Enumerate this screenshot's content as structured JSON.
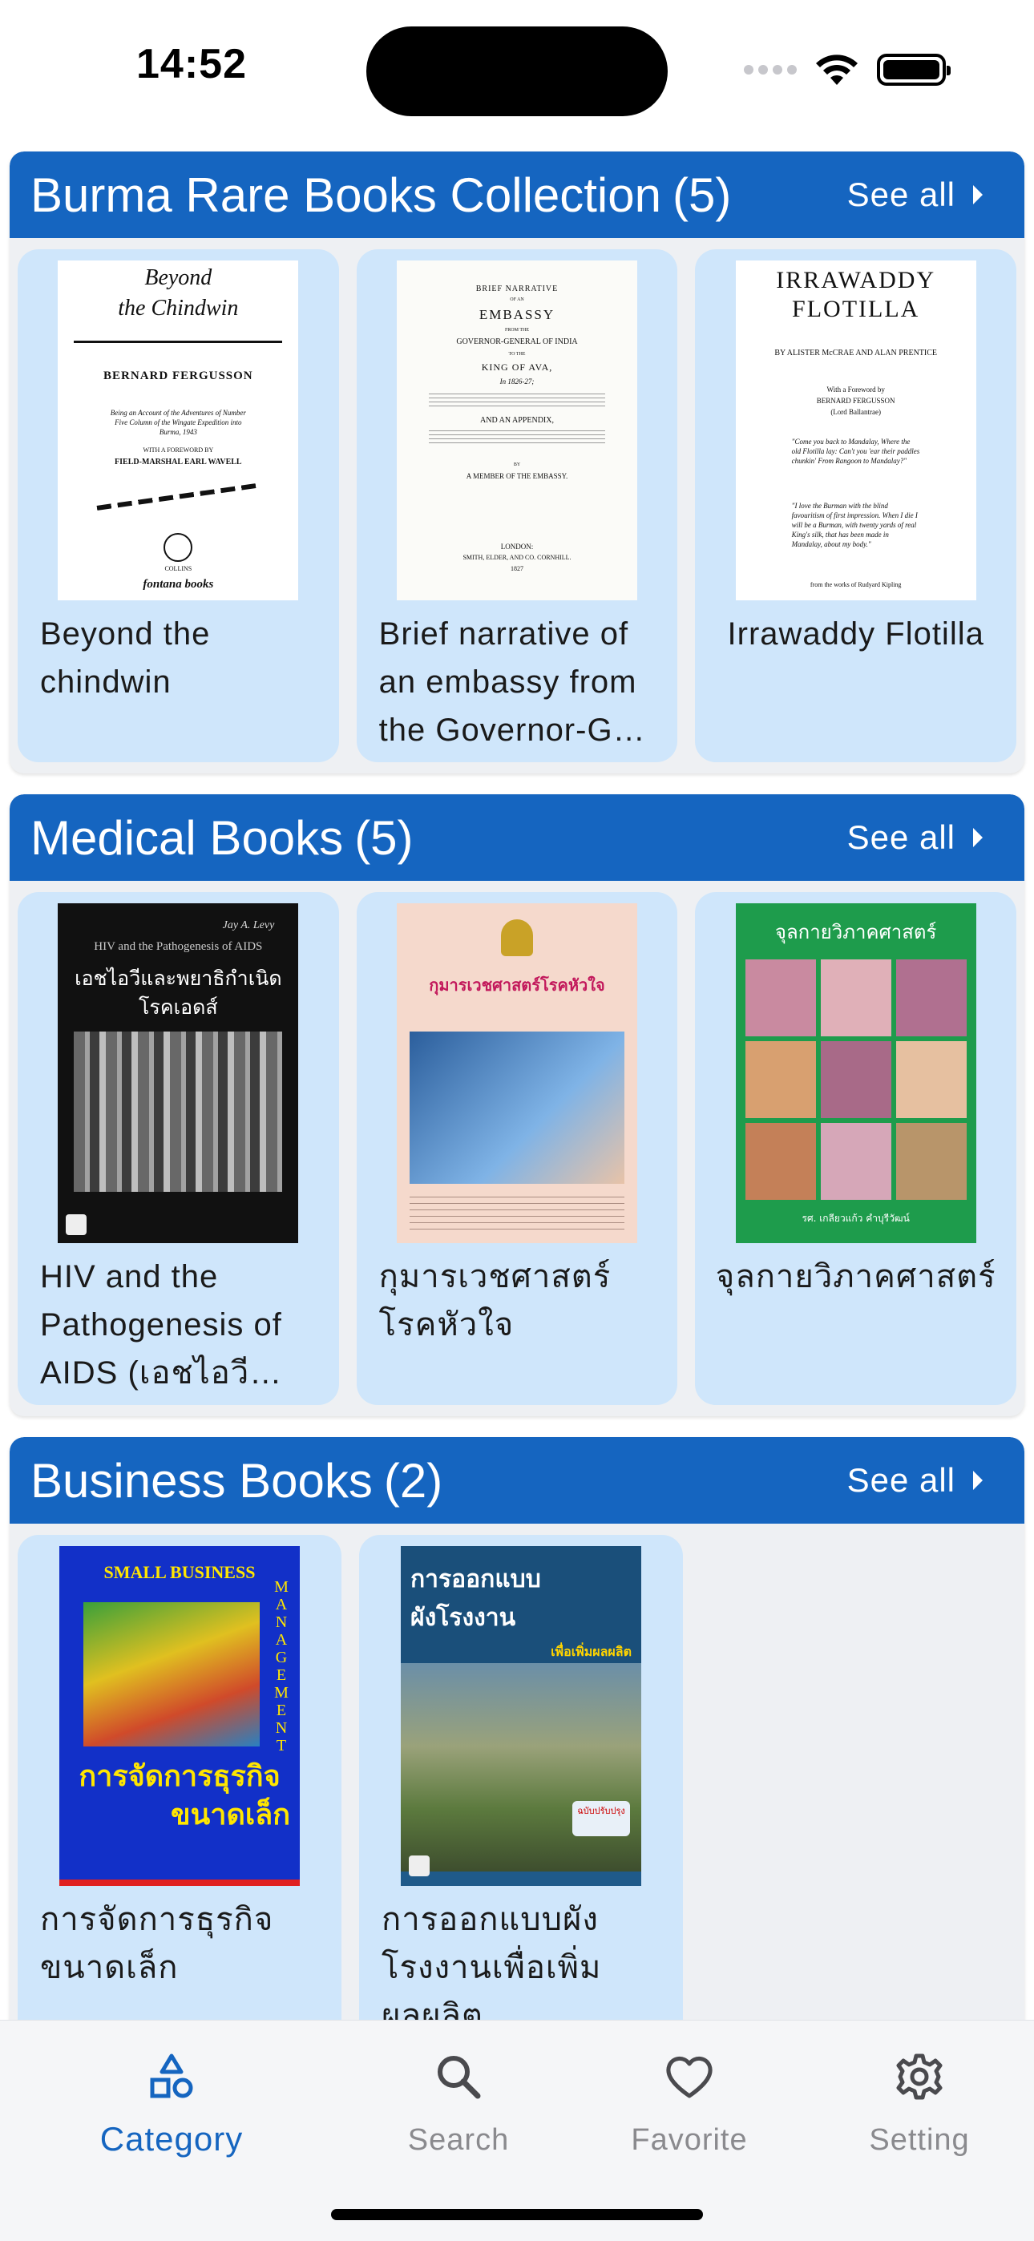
{
  "status_bar": {
    "time": "14:52"
  },
  "sections": [
    {
      "title": "Burma Rare Books Collection",
      "count": "(5)",
      "see_all": "See all",
      "books": [
        {
          "title": "Beyond the chindwin",
          "cover": {
            "line1": "Beyond",
            "line2": "the Chindwin",
            "author": "BERNARD FERGUSSON",
            "note": "Being an Account of the Adventures of Number Five Column of the Wingate Expedition into Burma, 1943",
            "foreword": "WITH A FOREWORD BY",
            "foreword_by": "FIELD-MARSHAL EARL WAVELL",
            "publisher1": "COLLINS",
            "publisher2": "fontana books"
          }
        },
        {
          "title": "Brief narrative of an embassy from the Governor-G…",
          "cover": {
            "l1": "BRIEF NARRATIVE",
            "l2": "OF AN",
            "l3": "EMBASSY",
            "l4": "FROM THE",
            "l5": "GOVERNOR-GENERAL OF INDIA",
            "l6": "TO THE",
            "l7": "KING OF AVA,",
            "l8": "In 1826-27;",
            "l9": "AND AN APPENDIX,",
            "l10": "BY",
            "l11": "A MEMBER OF THE EMBASSY.",
            "l12": "LONDON:",
            "l13": "SMITH, ELDER, AND CO. CORNHILL.",
            "l14": "1827"
          }
        },
        {
          "title": "Irrawaddy Flotilla",
          "cover": {
            "l1": "IRRAWADDY",
            "l2": "FLOTILLA",
            "l3": "BY ALISTER McCRAE AND ALAN PRENTICE",
            "l4": "With a Foreword by",
            "l5": "BERNARD FERGUSSON",
            "l6": "(Lord Ballantrae)",
            "q1": "\"Come you back to Mandalay, Where the old Flotilla lay: Can't you 'ear their paddles chunkin' From Rangoon to Mandalay?\"",
            "q2": "\"I love the Burman with the blind favouritism of first impression. When I die I will be a Burman, with twenty yards of real King's silk, that has been made in Mandalay, about my body.\"",
            "q3": "from the works of Rudyard Kipling"
          }
        }
      ]
    },
    {
      "title": "Medical Books",
      "count": "(5)",
      "see_all": "See all",
      "books": [
        {
          "title": "HIV and the Pathogenesis of AIDS (เอชไอวีแล…",
          "cover": {
            "author": "Jay A. Levy",
            "en": "HIV and the Pathogenesis of AIDS",
            "th": "เอชไอวีและพยาธิกำเนิดโรคเอดส์"
          }
        },
        {
          "title": "กุมารเวชศาสตร์โรคหัวใจ",
          "cover": {
            "th": "กุมารเวชศาสตร์โรคหัวใจ"
          }
        },
        {
          "title": "จุลกายวิภาคศาสตร์",
          "cover": {
            "th": "จุลกายวิภาคศาสตร์",
            "author": "รศ. เกลียวแก้ว คำบุรีวัฒน์"
          }
        }
      ]
    },
    {
      "title": "Business Books",
      "count": "(2)",
      "see_all": "See all",
      "books": [
        {
          "title": "การจัดการธุรกิจขนาดเล็ก",
          "cover": {
            "en1": "SMALL BUSINESS",
            "en2": "MANAGEMENT",
            "th1": "การจัดการธุรกิจ",
            "th2": "ขนาดเล็ก"
          }
        },
        {
          "title": "การออกแบบผังโรงงานเพื่อเพิ่มผลผลิต",
          "cover": {
            "th1": "การออกแบบ",
            "th2": "ผังโรงงาน",
            "th3": "เพื่อเพิ่มผลผลิต",
            "badge": "ฉบับปรับปรุง"
          }
        }
      ]
    }
  ],
  "tabs": [
    {
      "label": "Category",
      "icon": "category-icon",
      "active": true
    },
    {
      "label": "Search",
      "icon": "search-icon",
      "active": false
    },
    {
      "label": "Favorite",
      "icon": "heart-icon",
      "active": false
    },
    {
      "label": "Setting",
      "icon": "gear-icon",
      "active": false
    }
  ],
  "colors": {
    "header": "#1565c0",
    "card": "#cfe6fb",
    "active_tab": "#1565c0",
    "inactive_tab": "#8a8a8e"
  }
}
